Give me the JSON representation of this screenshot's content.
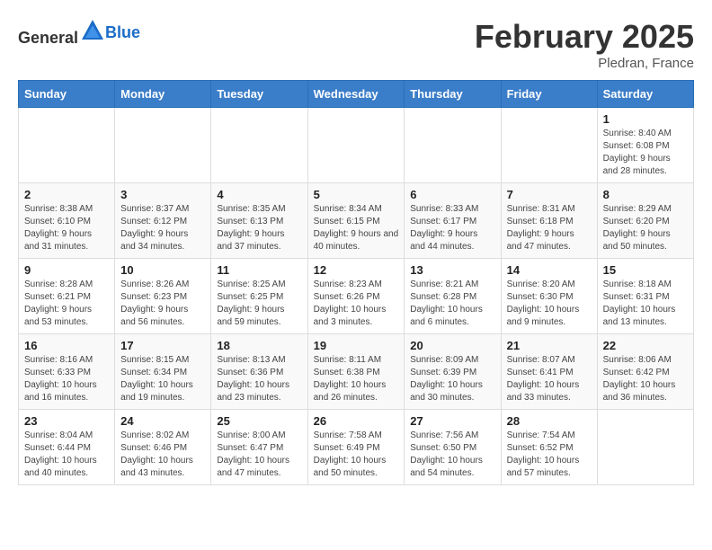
{
  "logo": {
    "general": "General",
    "blue": "Blue"
  },
  "title": "February 2025",
  "subtitle": "Pledran, France",
  "weekdays": [
    "Sunday",
    "Monday",
    "Tuesday",
    "Wednesday",
    "Thursday",
    "Friday",
    "Saturday"
  ],
  "weeks": [
    [
      {
        "day": "",
        "info": ""
      },
      {
        "day": "",
        "info": ""
      },
      {
        "day": "",
        "info": ""
      },
      {
        "day": "",
        "info": ""
      },
      {
        "day": "",
        "info": ""
      },
      {
        "day": "",
        "info": ""
      },
      {
        "day": "1",
        "info": "Sunrise: 8:40 AM\nSunset: 6:08 PM\nDaylight: 9 hours and 28 minutes."
      }
    ],
    [
      {
        "day": "2",
        "info": "Sunrise: 8:38 AM\nSunset: 6:10 PM\nDaylight: 9 hours and 31 minutes."
      },
      {
        "day": "3",
        "info": "Sunrise: 8:37 AM\nSunset: 6:12 PM\nDaylight: 9 hours and 34 minutes."
      },
      {
        "day": "4",
        "info": "Sunrise: 8:35 AM\nSunset: 6:13 PM\nDaylight: 9 hours and 37 minutes."
      },
      {
        "day": "5",
        "info": "Sunrise: 8:34 AM\nSunset: 6:15 PM\nDaylight: 9 hours and 40 minutes."
      },
      {
        "day": "6",
        "info": "Sunrise: 8:33 AM\nSunset: 6:17 PM\nDaylight: 9 hours and 44 minutes."
      },
      {
        "day": "7",
        "info": "Sunrise: 8:31 AM\nSunset: 6:18 PM\nDaylight: 9 hours and 47 minutes."
      },
      {
        "day": "8",
        "info": "Sunrise: 8:29 AM\nSunset: 6:20 PM\nDaylight: 9 hours and 50 minutes."
      }
    ],
    [
      {
        "day": "9",
        "info": "Sunrise: 8:28 AM\nSunset: 6:21 PM\nDaylight: 9 hours and 53 minutes."
      },
      {
        "day": "10",
        "info": "Sunrise: 8:26 AM\nSunset: 6:23 PM\nDaylight: 9 hours and 56 minutes."
      },
      {
        "day": "11",
        "info": "Sunrise: 8:25 AM\nSunset: 6:25 PM\nDaylight: 9 hours and 59 minutes."
      },
      {
        "day": "12",
        "info": "Sunrise: 8:23 AM\nSunset: 6:26 PM\nDaylight: 10 hours and 3 minutes."
      },
      {
        "day": "13",
        "info": "Sunrise: 8:21 AM\nSunset: 6:28 PM\nDaylight: 10 hours and 6 minutes."
      },
      {
        "day": "14",
        "info": "Sunrise: 8:20 AM\nSunset: 6:30 PM\nDaylight: 10 hours and 9 minutes."
      },
      {
        "day": "15",
        "info": "Sunrise: 8:18 AM\nSunset: 6:31 PM\nDaylight: 10 hours and 13 minutes."
      }
    ],
    [
      {
        "day": "16",
        "info": "Sunrise: 8:16 AM\nSunset: 6:33 PM\nDaylight: 10 hours and 16 minutes."
      },
      {
        "day": "17",
        "info": "Sunrise: 8:15 AM\nSunset: 6:34 PM\nDaylight: 10 hours and 19 minutes."
      },
      {
        "day": "18",
        "info": "Sunrise: 8:13 AM\nSunset: 6:36 PM\nDaylight: 10 hours and 23 minutes."
      },
      {
        "day": "19",
        "info": "Sunrise: 8:11 AM\nSunset: 6:38 PM\nDaylight: 10 hours and 26 minutes."
      },
      {
        "day": "20",
        "info": "Sunrise: 8:09 AM\nSunset: 6:39 PM\nDaylight: 10 hours and 30 minutes."
      },
      {
        "day": "21",
        "info": "Sunrise: 8:07 AM\nSunset: 6:41 PM\nDaylight: 10 hours and 33 minutes."
      },
      {
        "day": "22",
        "info": "Sunrise: 8:06 AM\nSunset: 6:42 PM\nDaylight: 10 hours and 36 minutes."
      }
    ],
    [
      {
        "day": "23",
        "info": "Sunrise: 8:04 AM\nSunset: 6:44 PM\nDaylight: 10 hours and 40 minutes."
      },
      {
        "day": "24",
        "info": "Sunrise: 8:02 AM\nSunset: 6:46 PM\nDaylight: 10 hours and 43 minutes."
      },
      {
        "day": "25",
        "info": "Sunrise: 8:00 AM\nSunset: 6:47 PM\nDaylight: 10 hours and 47 minutes."
      },
      {
        "day": "26",
        "info": "Sunrise: 7:58 AM\nSunset: 6:49 PM\nDaylight: 10 hours and 50 minutes."
      },
      {
        "day": "27",
        "info": "Sunrise: 7:56 AM\nSunset: 6:50 PM\nDaylight: 10 hours and 54 minutes."
      },
      {
        "day": "28",
        "info": "Sunrise: 7:54 AM\nSunset: 6:52 PM\nDaylight: 10 hours and 57 minutes."
      },
      {
        "day": "",
        "info": ""
      }
    ]
  ]
}
